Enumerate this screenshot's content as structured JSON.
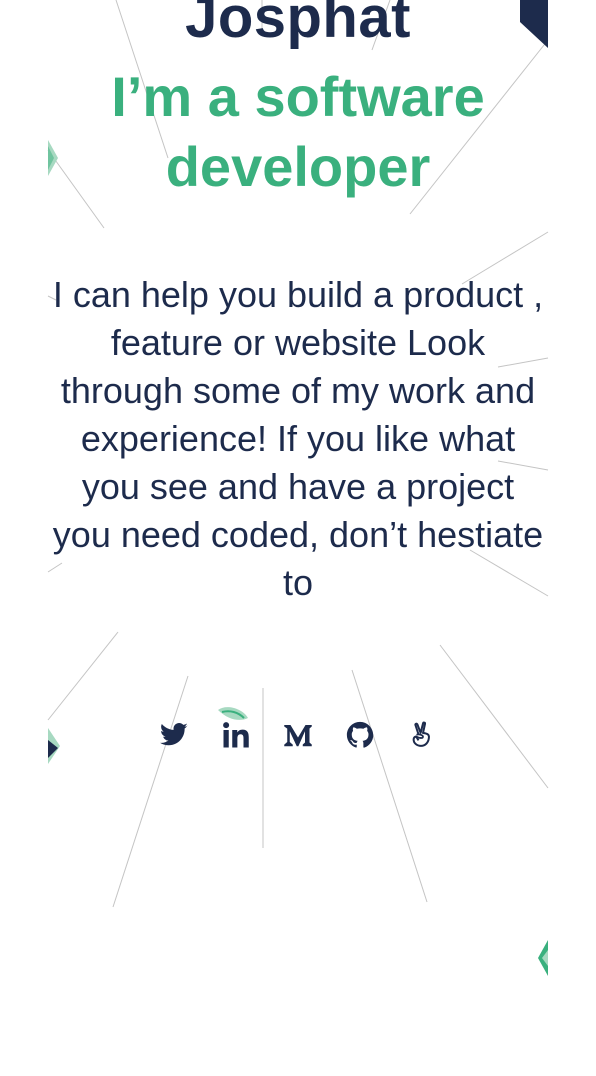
{
  "hero": {
    "name": "Josphat",
    "tagline_line1": "I’m a software",
    "tagline_line2": "developer",
    "intro": "I can help you build a product , feature or website Look through some of my work and experience! If you like what you see and have a project you need coded, don’t hestiate to"
  },
  "socials": [
    {
      "name": "Twitter",
      "icon": "twitter-icon"
    },
    {
      "name": "LinkedIn",
      "icon": "linkedin-icon"
    },
    {
      "name": "Medium",
      "icon": "medium-icon"
    },
    {
      "name": "GitHub",
      "icon": "github-icon"
    },
    {
      "name": "AngelList",
      "icon": "angellist-icon"
    }
  ],
  "colors": {
    "navy": "#1d2b4c",
    "green": "#3ab07e",
    "line": "#c8c8c8"
  }
}
